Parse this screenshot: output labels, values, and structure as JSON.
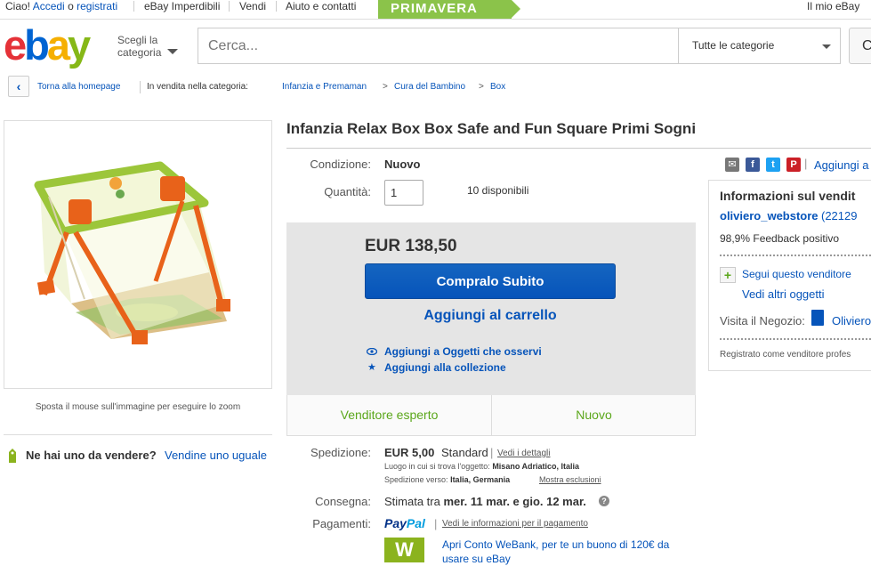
{
  "topbar": {
    "greeting": "Ciao!",
    "login": "Accedi",
    "or": "o",
    "register": "registrati",
    "deals": "eBay Imperdibili",
    "sell": "Vendi",
    "help": "Aiuto e contatti",
    "promo": "PRIMAVERA",
    "myebay": "Il mio eBay"
  },
  "header": {
    "shop_by_category": "Scegli la categoria",
    "search_placeholder": "Cerca...",
    "category_select": "Tutte le categorie",
    "search_button": "C"
  },
  "breadcrumb": {
    "back": "Torna alla homepage",
    "listed_in": "In vendita nella categoria:",
    "cat1": "Infanzia e Premaman",
    "cat2": "Cura del Bambino",
    "cat3": "Box",
    "sep": ">"
  },
  "image": {
    "zoom_hint": "Sposta il mouse sull'immagine per eseguire lo zoom"
  },
  "sell_one": {
    "question": "Ne hai uno da vendere?",
    "link": "Vendine uno uguale"
  },
  "item": {
    "title": "Infanzia Relax Box Box Safe and Fun Square Primi Sogni",
    "condition_label": "Condizione:",
    "condition_value": "Nuovo",
    "quantity_label": "Quantità:",
    "quantity_value": "1",
    "available": "10 disponibili",
    "price": "EUR 138,50",
    "buy_now": "Compralo Subito",
    "add_to_cart": "Aggiungi al carrello",
    "add_watch": "Aggiungi a Oggetti che osservi",
    "add_collection": "Aggiungi alla collezione",
    "badge1": "Venditore esperto",
    "badge2": "Nuovo"
  },
  "shipping": {
    "label": "Spedizione:",
    "cost": "EUR 5,00",
    "method": "Standard",
    "sep": "|",
    "details": "Vedi i dettagli",
    "location_label": "Luogo in cui si trova l'oggetto:",
    "location": "Misano Adriatico, Italia",
    "to_label": "Spedizione verso:",
    "to": "Italia, Germania",
    "exclusions": "Mostra esclusioni",
    "delivery_label": "Consegna:",
    "delivery_pre": "Stimata tra",
    "delivery_range": "mer. 11 mar. e gio. 12 mar.",
    "help": "?",
    "payment_label": "Pagamenti:",
    "paypal_a": "Pay",
    "paypal_b": "Pal",
    "payment_info": "Vedi le informazioni per il pagamento",
    "webank_logo": "W",
    "webank_line1": "Apri Conto WeBank, per te un buono di 120€ da",
    "webank_line2": "usare su eBay"
  },
  "seller": {
    "share_sep": "|",
    "watch_link": "Aggiungi a",
    "info_title": "Informazioni sul vendit",
    "name": "oliviero_webstore",
    "score": "(22129",
    "feedback": "98,9% Feedback positivo",
    "follow": "Segui questo venditore",
    "other_items": "Vedi altri oggetti",
    "store_label": "Visita il Negozio:",
    "store_name": "Oliviero",
    "registered": "Registrato come venditore profes"
  },
  "icons": [
    "chevron-left-icon",
    "caret-down-icon",
    "envelope-icon",
    "facebook-icon",
    "twitter-icon",
    "pinterest-icon",
    "eye-icon",
    "star-icon",
    "tag-icon",
    "plus-icon",
    "store-door-icon",
    "help-icon"
  ],
  "colors": {
    "link": "#0654ba",
    "buy_button": "#0654ba",
    "badge_green": "#5ba71b",
    "promo_green": "#8bc34a",
    "webank_green": "#8bb31e"
  }
}
